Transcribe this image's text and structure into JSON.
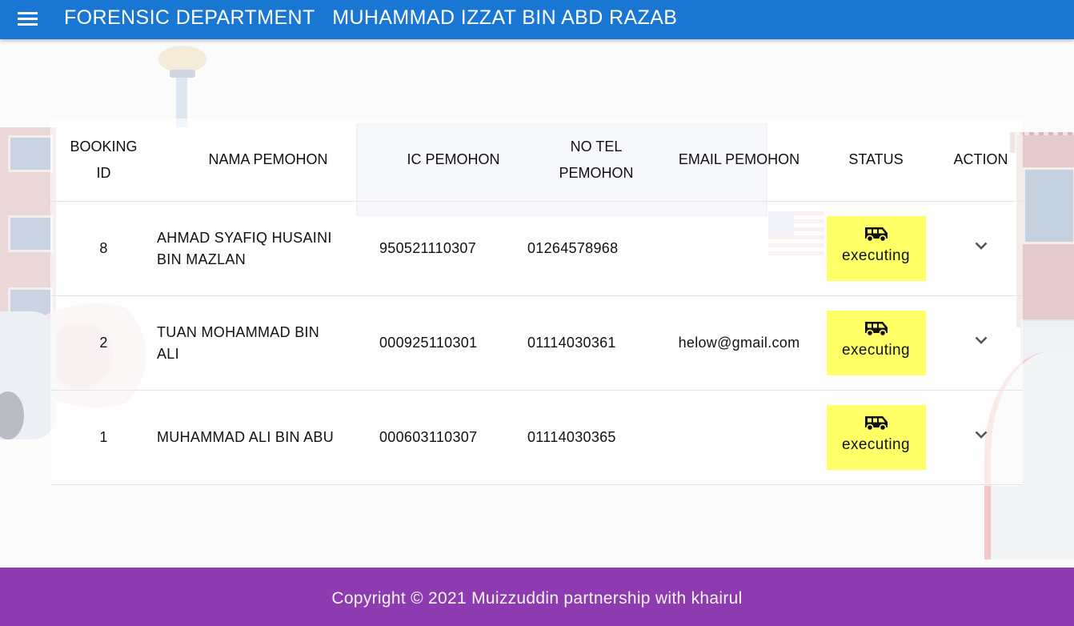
{
  "appbar": {
    "menu_icon": "menu-icon",
    "title": "FORENSIC DEPARTMENT   MUHAMMAD IZZAT BIN ABD RAZAB",
    "background": "#1976d2"
  },
  "table": {
    "headers": {
      "booking_id": "BOOKING ID",
      "nama_pemohon": "NAMA PEMOHON",
      "ic_pemohon": "IC PEMOHON",
      "no_tel_pemohon": "NO TEL PEMOHON",
      "email_pemohon": "EMAIL PEMOHON",
      "status": "STATUS",
      "action": "ACTION"
    },
    "rows": [
      {
        "booking_id": "8",
        "nama": "AHMAD SYAFIQ HUSAINI BIN MAZLAN",
        "ic": "950521110307",
        "tel": "01264578968",
        "email": "",
        "status": "executing",
        "status_icon": "van-icon",
        "action_icon": "chevron-down-icon"
      },
      {
        "booking_id": "2",
        "nama": "TUAN MOHAMMAD BIN ALI",
        "ic": "000925110301",
        "tel": "01114030361",
        "email": "helow@gmail.com",
        "status": "executing",
        "status_icon": "van-icon",
        "action_icon": "chevron-down-icon"
      },
      {
        "booking_id": "1",
        "nama": "MUHAMMAD ALI BIN ABU",
        "ic": "000603110307",
        "tel": "01114030365",
        "email": "",
        "status": "executing",
        "status_icon": "van-icon",
        "action_icon": "chevron-down-icon"
      }
    ],
    "status_color": "#ffff66"
  },
  "footer": {
    "text": "Copyright © 2021 Muizzuddin partnership with khairul",
    "background": "#8e3ab0"
  }
}
